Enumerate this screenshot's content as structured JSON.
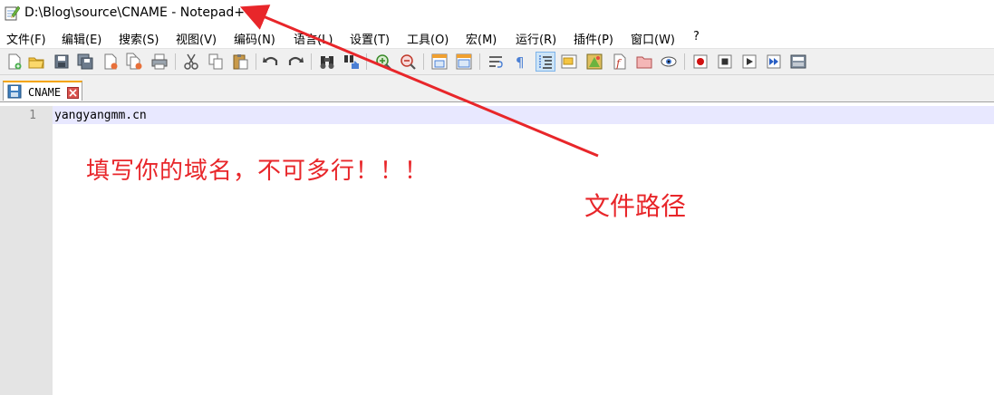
{
  "window": {
    "title": "D:\\Blog\\source\\CNAME - Notepad++"
  },
  "menu": {
    "items": [
      "文件(F)",
      "编辑(E)",
      "搜索(S)",
      "视图(V)",
      "编码(N)",
      "语言(L)",
      "设置(T)",
      "工具(O)",
      "宏(M)",
      "运行(R)",
      "插件(P)",
      "窗口(W)",
      "?"
    ]
  },
  "toolbar": {
    "icons": [
      "new-file-icon",
      "open-file-icon",
      "save-icon",
      "save-all-icon",
      "close-icon",
      "close-all-icon",
      "print-icon",
      "cut-icon",
      "copy-icon",
      "paste-icon",
      "undo-icon",
      "redo-icon",
      "find-icon",
      "replace-icon",
      "zoom-in-icon",
      "zoom-out-icon",
      "sync-vertical-icon",
      "sync-horizontal-icon",
      "word-wrap-icon",
      "show-all-chars-icon",
      "indent-guide-icon",
      "doc-map-icon",
      "function-list-icon",
      "folder-as-workspace-icon",
      "udl-icon",
      "monitor-icon",
      "record-macro-icon",
      "stop-macro-icon",
      "play-macro-icon",
      "run-macro-multiple-icon",
      "save-macro-icon"
    ]
  },
  "tab": {
    "label": "CNAME"
  },
  "editor": {
    "line_number": "1",
    "content": "yangyangmm.cn"
  },
  "annotations": {
    "domain_note": "填写你的域名，不可多行！！！",
    "path_note": "文件路径",
    "color": "#e8262a"
  }
}
